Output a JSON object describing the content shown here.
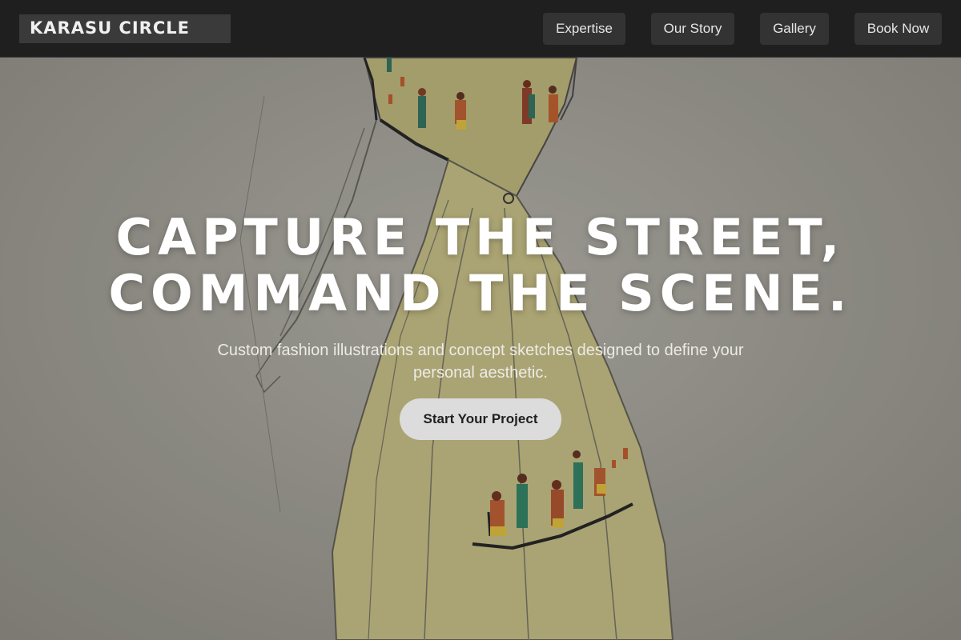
{
  "header": {
    "logo_text": "KARASU CIRCLE",
    "nav": [
      {
        "label": "Expertise"
      },
      {
        "label": "Our Story"
      },
      {
        "label": "Gallery"
      },
      {
        "label": "Book Now"
      }
    ]
  },
  "hero": {
    "title_line_1": "CAPTURE THE STREET,",
    "title_line_2": "COMMAND THE SCENE.",
    "subtitle": "Custom fashion illustrations and concept sketches designed to define your personal aesthetic.",
    "cta_label": "Start Your Project",
    "background_image": "fashion-sketch-dress"
  },
  "colors": {
    "header_bg": "#1f1f1f",
    "nav_button_bg": "#333333",
    "cta_bg": "#dcdcdc",
    "title_text": "#ffffff"
  }
}
